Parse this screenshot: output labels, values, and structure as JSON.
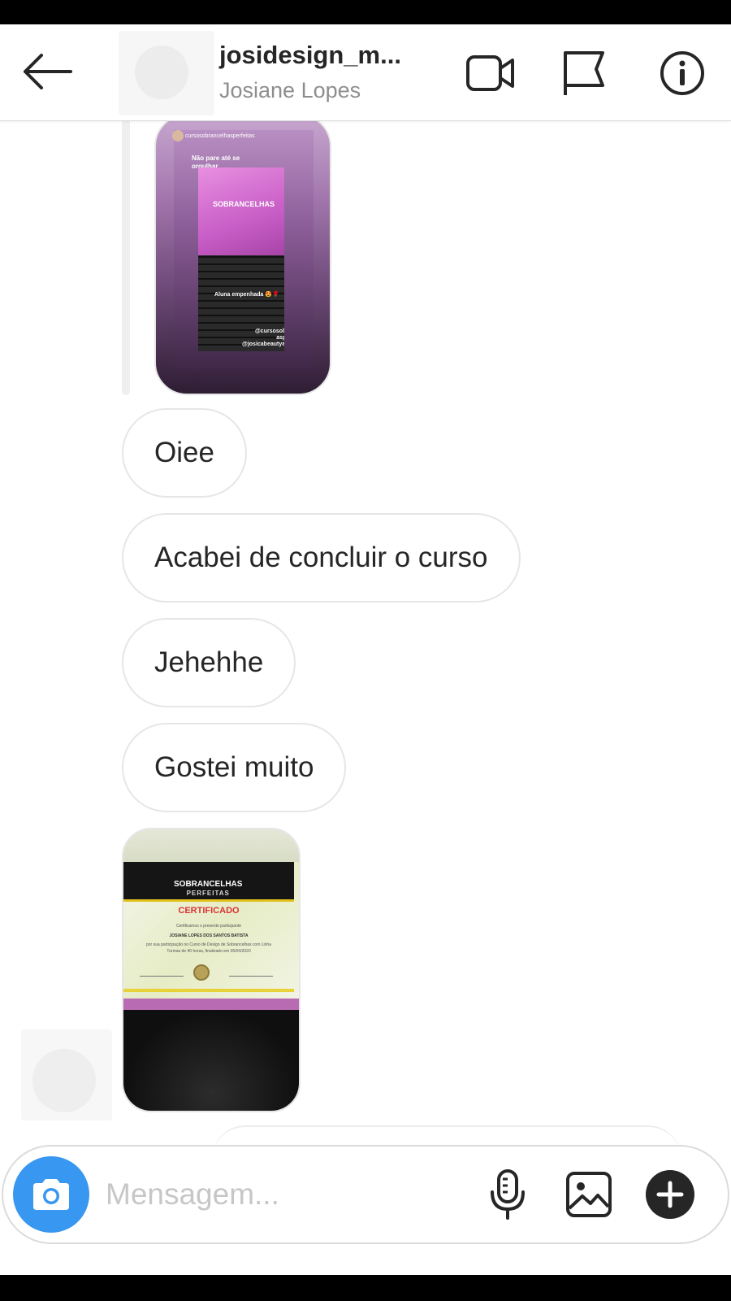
{
  "header": {
    "username": "josidesign_m...",
    "full_name": "Josiane Lopes",
    "icons": [
      "back-arrow-icon",
      "video-call-icon",
      "flag-icon",
      "info-icon"
    ]
  },
  "story_share": {
    "top_user": "cursosobrancelhasperfeitas",
    "caption": "Não pare até se orgulhar",
    "screen_logo": "SOBRANCELHAS",
    "sticker_text": "Aluna empenhada 😍🌹",
    "handle_lines": [
      "@cursosobrancelh",
      "asperfeitas",
      "@josicabeautyacademy"
    ]
  },
  "messages": [
    {
      "text": "Oiee"
    },
    {
      "text": "Acabei de concluir o curso"
    },
    {
      "text": "Jehehhe"
    },
    {
      "text": "Gostei muito"
    }
  ],
  "certificate_photo": {
    "logo_top": "SOBRANCELHAS",
    "logo_bottom": "PERFEITAS",
    "title": "CERTIFICADO",
    "lines": [
      "Certificamos o presente participante",
      "JOSIANE LOPES DOS SANTOS BATISTA",
      "por sua participação no Curso de Design de Sobrancelhas com Linha",
      "Turmas de 40 horas, finalizado em 05/04/2020"
    ]
  },
  "composer": {
    "placeholder": "Mensagem...",
    "icons": [
      "camera-icon",
      "microphone-icon",
      "gallery-icon",
      "plus-icon"
    ]
  },
  "colors": {
    "accent_blue": "#3897f0",
    "text_primary": "#262626",
    "text_secondary": "#8e8e8e",
    "bubble_border": "#e6e6e6"
  }
}
